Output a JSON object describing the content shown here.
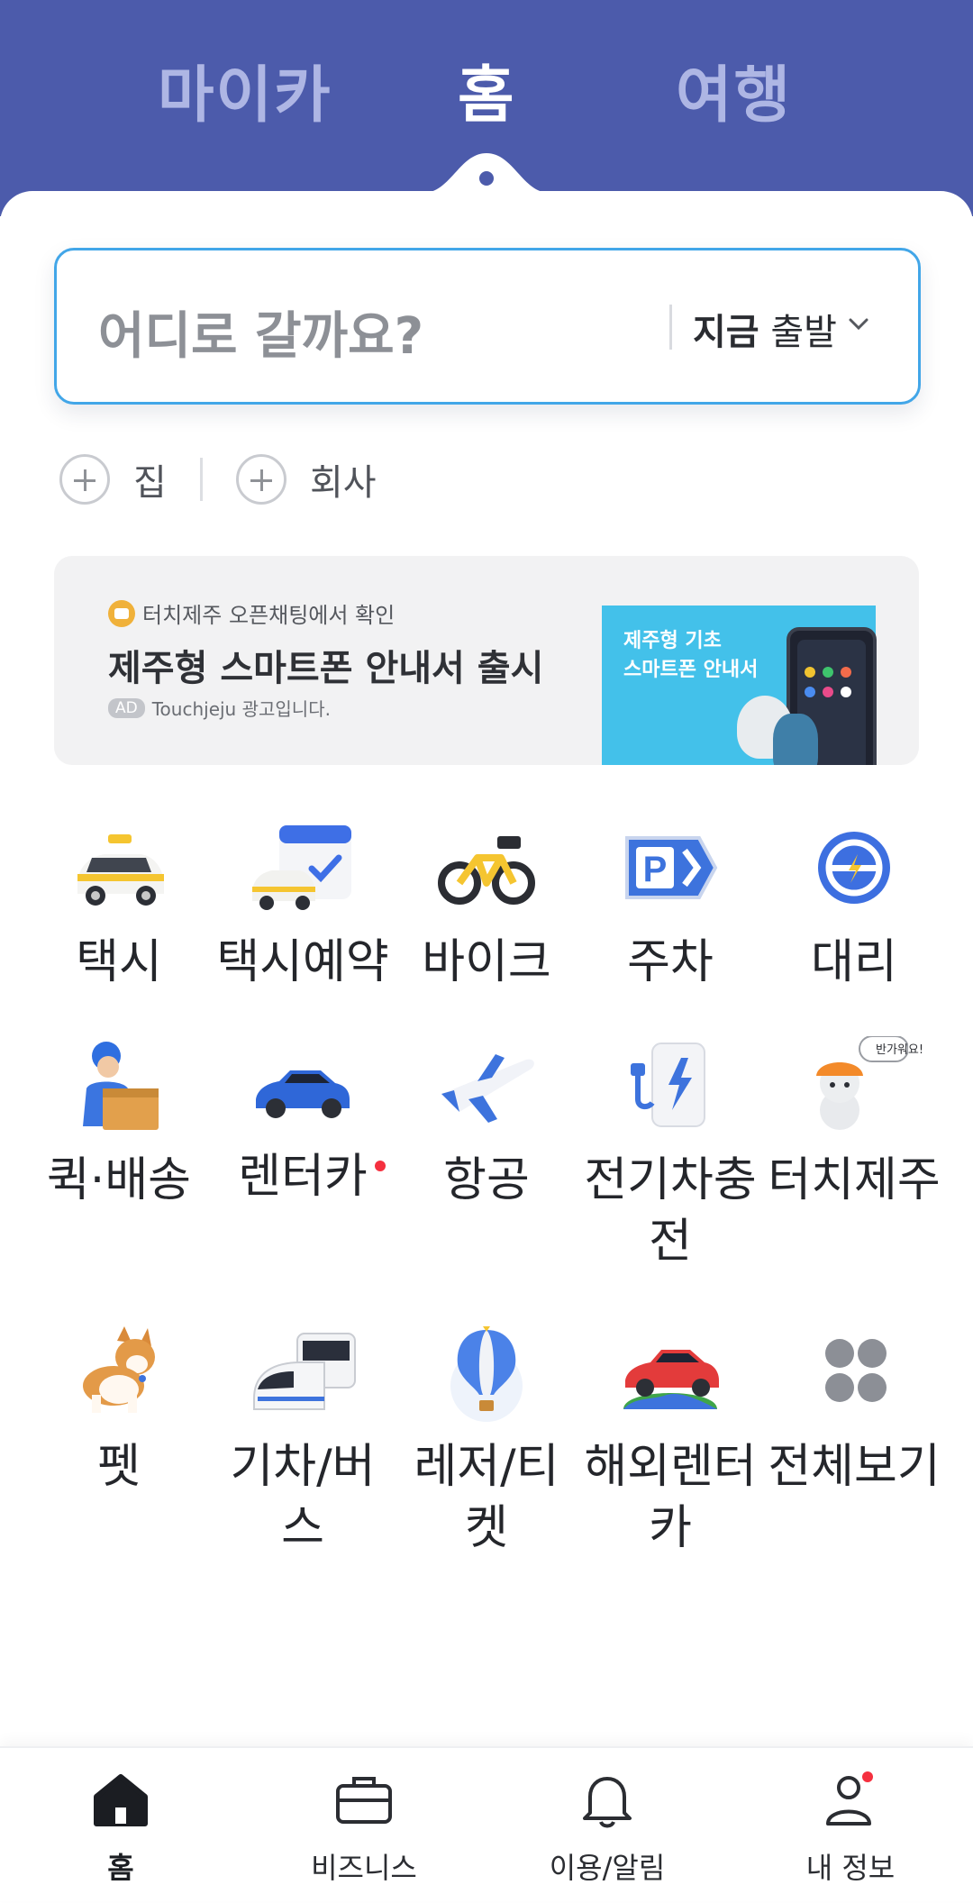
{
  "header": {
    "tabs": [
      {
        "label": "마이카",
        "active": false
      },
      {
        "label": "홈",
        "active": true
      },
      {
        "label": "여행",
        "active": false
      }
    ],
    "background": "#4c5bab"
  },
  "search": {
    "placeholder": "어디로 갈까요?",
    "depart_strong": "지금",
    "depart_label": "출발"
  },
  "shortcuts": [
    {
      "label": "집"
    },
    {
      "label": "회사"
    }
  ],
  "banner": {
    "source": "터치제주 오픈채팅에서 확인",
    "title": "제주형 스마트폰 안내서 출시",
    "ad_badge": "AD",
    "ad_text": "Touchjeju 광고입니다.",
    "image_text": "제주형 기초\n스마트폰 안내서"
  },
  "services": [
    {
      "label": "택시",
      "icon": "taxi-icon"
    },
    {
      "label": "택시예약",
      "icon": "taxi-reservation-icon"
    },
    {
      "label": "바이크",
      "icon": "bike-icon"
    },
    {
      "label": "주차",
      "icon": "parking-icon"
    },
    {
      "label": "대리",
      "icon": "driver-icon"
    },
    {
      "label": "퀵·배송",
      "icon": "delivery-icon"
    },
    {
      "label": "렌터카",
      "icon": "rentacar-icon",
      "badge": true
    },
    {
      "label": "항공",
      "icon": "airplane-icon"
    },
    {
      "label": "전기차충전",
      "icon": "ev-charging-icon"
    },
    {
      "label": "터치제주",
      "icon": "touchjeju-icon",
      "bubble": "반가워요!"
    },
    {
      "label": "펫",
      "icon": "pet-icon"
    },
    {
      "label": "기차/버스",
      "icon": "train-bus-icon"
    },
    {
      "label": "레저/티켓",
      "icon": "balloon-icon"
    },
    {
      "label": "해외렌터카",
      "icon": "overseas-rentacar-icon"
    },
    {
      "label": "전체보기",
      "icon": "view-all-icon"
    }
  ],
  "bottom_nav": [
    {
      "label": "홈",
      "icon": "home-icon",
      "active": true
    },
    {
      "label": "비즈니스",
      "icon": "briefcase-icon",
      "active": false
    },
    {
      "label": "이용/알림",
      "icon": "bell-icon",
      "active": false
    },
    {
      "label": "내 정보",
      "icon": "person-icon",
      "active": false,
      "badge": true
    }
  ],
  "colors": {
    "accent_red": "#f5303f",
    "search_border": "#42a6e8"
  }
}
